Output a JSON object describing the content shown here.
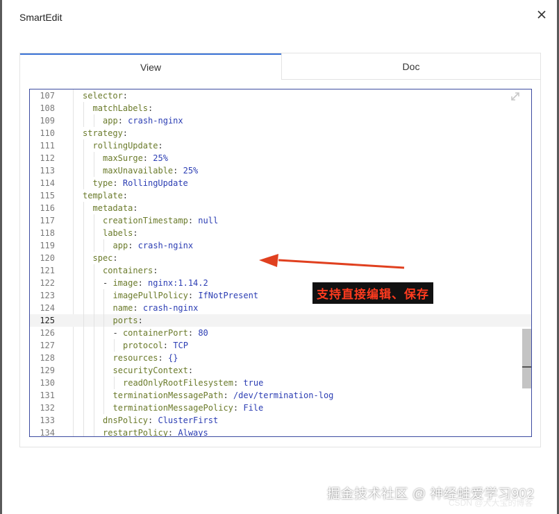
{
  "dialog": {
    "title": "SmartEdit",
    "close_icon": "close-icon"
  },
  "tabs": [
    {
      "label": "View",
      "active": true
    },
    {
      "label": "Doc",
      "active": false
    }
  ],
  "editor": {
    "active_line": 125,
    "lines": [
      {
        "no": "107",
        "indent": 0,
        "key": "selector",
        "sep": ":",
        "val": ""
      },
      {
        "no": "108",
        "indent": 1,
        "key": "matchLabels",
        "sep": ":",
        "val": ""
      },
      {
        "no": "109",
        "indent": 2,
        "key": "app",
        "sep": ": ",
        "val": "crash-nginx"
      },
      {
        "no": "110",
        "indent": 0,
        "key": "strategy",
        "sep": ":",
        "val": ""
      },
      {
        "no": "111",
        "indent": 1,
        "key": "rollingUpdate",
        "sep": ":",
        "val": ""
      },
      {
        "no": "112",
        "indent": 2,
        "key": "maxSurge",
        "sep": ": ",
        "val": "25%"
      },
      {
        "no": "113",
        "indent": 2,
        "key": "maxUnavailable",
        "sep": ": ",
        "val": "25%"
      },
      {
        "no": "114",
        "indent": 1,
        "key": "type",
        "sep": ": ",
        "val": "RollingUpdate"
      },
      {
        "no": "115",
        "indent": 0,
        "key": "template",
        "sep": ":",
        "val": ""
      },
      {
        "no": "116",
        "indent": 1,
        "key": "metadata",
        "sep": ":",
        "val": ""
      },
      {
        "no": "117",
        "indent": 2,
        "key": "creationTimestamp",
        "sep": ": ",
        "val": "null"
      },
      {
        "no": "118",
        "indent": 2,
        "key": "labels",
        "sep": ":",
        "val": ""
      },
      {
        "no": "119",
        "indent": 3,
        "key": "app",
        "sep": ": ",
        "val": "crash-nginx"
      },
      {
        "no": "120",
        "indent": 1,
        "key": "spec",
        "sep": ":",
        "val": ""
      },
      {
        "no": "121",
        "indent": 2,
        "key": "containers",
        "sep": ":",
        "val": ""
      },
      {
        "no": "122",
        "indent": 2,
        "dash": true,
        "key": "image",
        "sep": ": ",
        "val": "nginx:1.14.2"
      },
      {
        "no": "123",
        "indent": 3,
        "key": "imagePullPolicy",
        "sep": ": ",
        "val": "IfNotPresent"
      },
      {
        "no": "124",
        "indent": 3,
        "key": "name",
        "sep": ": ",
        "val": "crash-nginx"
      },
      {
        "no": "125",
        "indent": 3,
        "key": "ports",
        "sep": ":",
        "val": ""
      },
      {
        "no": "126",
        "indent": 3,
        "dash": true,
        "key": "containerPort",
        "sep": ": ",
        "val": "80"
      },
      {
        "no": "127",
        "indent": 4,
        "key": "protocol",
        "sep": ": ",
        "val": "TCP"
      },
      {
        "no": "128",
        "indent": 3,
        "key": "resources",
        "sep": ": ",
        "val": "{}"
      },
      {
        "no": "129",
        "indent": 3,
        "key": "securityContext",
        "sep": ":",
        "val": ""
      },
      {
        "no": "130",
        "indent": 4,
        "key": "readOnlyRootFilesystem",
        "sep": ": ",
        "val": "true"
      },
      {
        "no": "131",
        "indent": 3,
        "key": "terminationMessagePath",
        "sep": ": ",
        "val": "/dev/termination-log"
      },
      {
        "no": "132",
        "indent": 3,
        "key": "terminationMessagePolicy",
        "sep": ": ",
        "val": "File"
      },
      {
        "no": "133",
        "indent": 2,
        "key": "dnsPolicy",
        "sep": ": ",
        "val": "ClusterFirst"
      },
      {
        "no": "134",
        "indent": 2,
        "key": "restartPolicy",
        "sep": ": ",
        "val": "Always"
      }
    ]
  },
  "annotation": {
    "text": "支持直接编辑、保存",
    "color": "#ff3b1f"
  },
  "watermark": {
    "text": "掘金技术社区 @ 神经蛙爱学习902",
    "csdn": "CSDN @大大宝的博客"
  }
}
